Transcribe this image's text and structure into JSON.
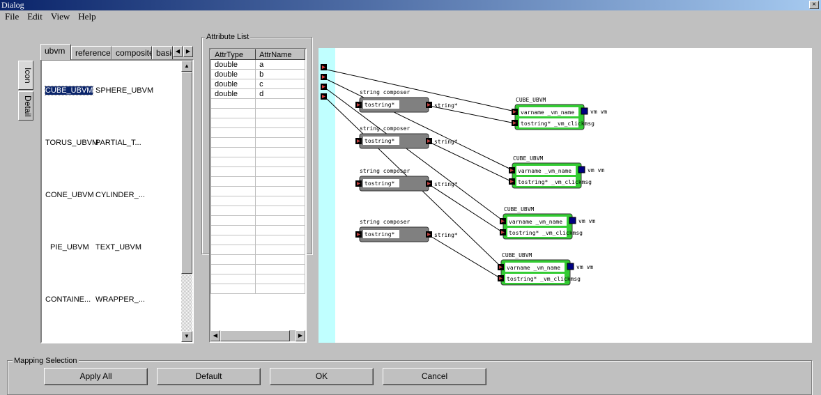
{
  "window": {
    "title": "Dialog",
    "close": "×"
  },
  "menu": [
    "File",
    "Edit",
    "View",
    "Help"
  ],
  "palette": {
    "tabs": [
      "ubvm",
      "reference",
      "composite",
      "basic"
    ],
    "view_tabs": [
      "Icon",
      "Detail"
    ],
    "items": [
      [
        "CUBE_UBVM",
        "SPHERE_UBVM"
      ],
      [
        "TORUS_UBVM",
        "PARTIAL_T..."
      ],
      [
        "CONE_UBVM",
        "CYLINDER_..."
      ],
      [
        "PIE_UBVM",
        "TEXT_UBVM"
      ],
      [
        "CONTAINE...",
        "WRAPPER_..."
      ]
    ],
    "selected": "CUBE_UBVM"
  },
  "attribute_list": {
    "label": "Attribute List",
    "columns": [
      "AttrType",
      "AttrName"
    ],
    "rows": [
      [
        "double",
        "a"
      ],
      [
        "double",
        "b"
      ],
      [
        "double",
        "c"
      ],
      [
        "double",
        "d"
      ]
    ]
  },
  "graph": {
    "composers": [
      {
        "title": "string composer",
        "input": "tostring*",
        "output": "string*"
      },
      {
        "title": "string composer",
        "input": "tostring*",
        "output": "string*"
      },
      {
        "title": "string composer",
        "input": "tostring*",
        "output": "string*"
      },
      {
        "title": "string composer",
        "input": "tostring*",
        "output": "string*"
      }
    ],
    "cubes": [
      {
        "title": "CUBE_UBVM",
        "row1": "varname _vm_name",
        "row2": "tostring* _vm_clickmsg",
        "out": "vm vm"
      },
      {
        "title": "CUBE_UBVM",
        "row1": "varname _vm_name",
        "row2": "tostring* _vm_clickmsg",
        "out": "vm vm"
      },
      {
        "title": "CUBE_UBVM",
        "row1": "varname _vm_name",
        "row2": "tostring* _vm_clickmsg",
        "out": "vm vm"
      },
      {
        "title": "CUBE_UBVM",
        "row1": "varname _vm_name",
        "row2": "tostring* _vm_clickmsg",
        "out": "vm vm"
      }
    ],
    "colors": {
      "cube": "#33cc33",
      "composer": "#808080",
      "port": "#8b1a1a",
      "vm_port": "#000080",
      "strip": "#c0ffff"
    }
  },
  "mapping": {
    "label": "Mapping Selection",
    "buttons": [
      "Apply All",
      "Default",
      "OK",
      "Cancel"
    ]
  }
}
